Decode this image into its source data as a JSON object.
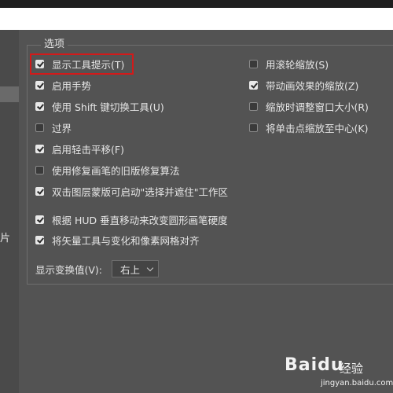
{
  "left_panel": {
    "clipped_label": "片"
  },
  "section": {
    "title": "选项"
  },
  "options_left": [
    {
      "label": "显示工具提示(T)",
      "checked": true
    },
    {
      "label": "启用手势",
      "checked": true
    },
    {
      "label": "使用 Shift 键切换工具(U)",
      "checked": true
    },
    {
      "label": "过界",
      "checked": false
    },
    {
      "label": "启用轻击平移(F)",
      "checked": true
    },
    {
      "label": "使用修复画笔的旧版修复算法",
      "checked": false
    },
    {
      "label": "双击图层蒙版可启动\"选择并遮住\"工作区",
      "checked": true
    },
    {
      "label": "根据 HUD 垂直移动来改变圆形画笔硬度",
      "checked": true
    },
    {
      "label": "将矢量工具与变化和像素网格对齐",
      "checked": true
    }
  ],
  "options_right": [
    {
      "label": "用滚轮缩放(S)",
      "checked": false
    },
    {
      "label": "带动画效果的缩放(Z)",
      "checked": true
    },
    {
      "label": "缩放时调整窗口大小(R)",
      "checked": false
    },
    {
      "label": "将单击点缩放至中心(K)",
      "checked": false
    }
  ],
  "transform_values": {
    "label": "显示变换值(V):",
    "selected": "右上"
  },
  "watermark": {
    "brand": "Baidu",
    "sub": "经验",
    "url": "jingyan.baidu.com"
  },
  "colors": {
    "highlight": "#d21a1a",
    "background": "#535353"
  }
}
